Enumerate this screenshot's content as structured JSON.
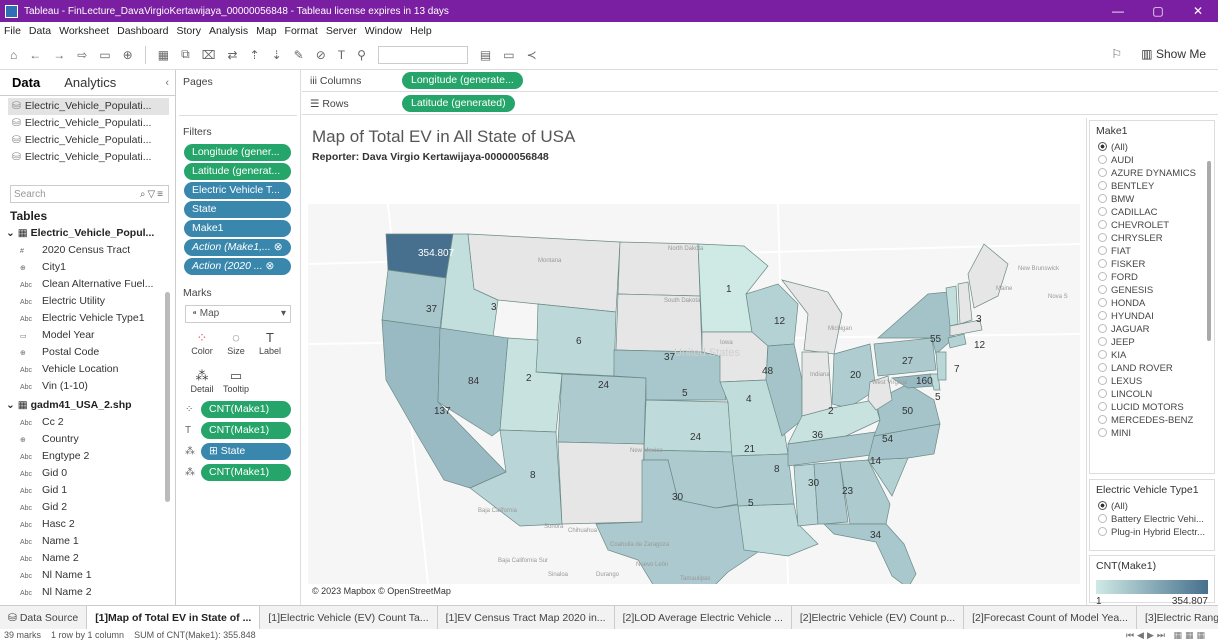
{
  "window": {
    "title": "Tableau - FinLecture_DavaVirgioKertawijaya_00000056848 - Tableau license expires in 13 days",
    "min": "—",
    "max": "▢",
    "close": "✕"
  },
  "menu": [
    "File",
    "Data",
    "Worksheet",
    "Dashboard",
    "Story",
    "Analysis",
    "Map",
    "Format",
    "Server",
    "Window",
    "Help"
  ],
  "toolbar": {
    "show_me": "Show Me"
  },
  "data_pane": {
    "tab_data": "Data",
    "tab_analytics": "Analytics",
    "datasources": [
      "Electric_Vehicle_Populati...",
      "Electric_Vehicle_Populati...",
      "Electric_Vehicle_Populati...",
      "Electric_Vehicle_Populati..."
    ],
    "search_placeholder": "Search",
    "tables_header": "Tables",
    "table1": "Electric_Vehicle_Popul...",
    "table1_fields": [
      {
        "t": "#",
        "n": "2020 Census Tract"
      },
      {
        "t": "⊕",
        "n": "City1"
      },
      {
        "t": "Abc",
        "n": "Clean Alternative Fuel..."
      },
      {
        "t": "Abc",
        "n": "Electric Utility"
      },
      {
        "t": "Abc",
        "n": "Electric Vehicle Type1"
      },
      {
        "t": "▭",
        "n": "Model Year"
      },
      {
        "t": "⊕",
        "n": "Postal Code"
      },
      {
        "t": "Abc",
        "n": "Vehicle Location"
      },
      {
        "t": "Abc",
        "n": "Vin (1-10)"
      }
    ],
    "table2": "gadm41_USA_2.shp",
    "table2_fields": [
      {
        "t": "Abc",
        "n": "Cc 2"
      },
      {
        "t": "⊕",
        "n": "Country"
      },
      {
        "t": "Abc",
        "n": "Engtype 2"
      },
      {
        "t": "Abc",
        "n": "Gid 0"
      },
      {
        "t": "Abc",
        "n": "Gid 1"
      },
      {
        "t": "Abc",
        "n": "Gid 2"
      },
      {
        "t": "Abc",
        "n": "Hasc 2"
      },
      {
        "t": "Abc",
        "n": "Name 1"
      },
      {
        "t": "Abc",
        "n": "Name 2"
      },
      {
        "t": "Abc",
        "n": "Nl Name 1"
      },
      {
        "t": "Abc",
        "n": "Nl Name 2"
      },
      {
        "t": "Abc",
        "n": "Type 2"
      },
      {
        "t": "Abc",
        "n": "Varname 2"
      }
    ]
  },
  "shelves": {
    "pages": "Pages",
    "filters": "Filters",
    "filter_pills": [
      {
        "label": "Longitude (gener...",
        "kind": "g"
      },
      {
        "label": "Latitude (generat...",
        "kind": "g"
      },
      {
        "label": "Electric Vehicle T...",
        "kind": "b"
      },
      {
        "label": "State",
        "kind": "b"
      },
      {
        "label": "Make1",
        "kind": "b"
      },
      {
        "label": "Action (Make1,... ⊗",
        "kind": "bi"
      },
      {
        "label": "Action (2020 ... ⊗",
        "kind": "bi"
      }
    ],
    "marks": "Marks",
    "mark_type": "Map",
    "mark_buttons": {
      "color": "Color",
      "size": "Size",
      "label": "Label",
      "detail": "Detail",
      "tooltip": "Tooltip"
    },
    "mark_pills": [
      {
        "icon": "⁘",
        "label": "CNT(Make1)",
        "kind": "g"
      },
      {
        "icon": "T",
        "label": "CNT(Make1)",
        "kind": "g"
      },
      {
        "icon": "⁂",
        "label": "⊞ State",
        "kind": "b"
      },
      {
        "icon": "⁂",
        "label": "CNT(Make1)",
        "kind": "g"
      }
    ],
    "columns_label": "iii Columns",
    "columns_pill": "Longitude (generate...",
    "rows_label": "☰ Rows",
    "rows_pill": "Latitude (generated)"
  },
  "view": {
    "title": "Map of Total EV in All State of USA",
    "subtitle": "Reporter: Dava Virgio Kertawijaya-00000056848",
    "copyright": "© 2023 Mapbox © OpenStreetMap",
    "basemap_labels": [
      "North Dakota",
      "South Dakota",
      "Montana",
      "New Brunswick",
      "Maine",
      "Nova S",
      "Michigan",
      "Iowa",
      "Indiana",
      "West Virginia",
      "New Mexico",
      "Baja California",
      "Sonora",
      "Chihuahua",
      "Coahuila de Zaragoza",
      "Baja California Sur",
      "Sinaloa",
      "Durango",
      "Nuevo León",
      "Tamaulipas",
      "Mexico",
      "United States"
    ],
    "state_counts": [
      {
        "name": "Washington",
        "value": 354807
      },
      {
        "name": "Oregon",
        "value": 37
      },
      {
        "name": "Idaho",
        "value": 3
      },
      {
        "name": "California",
        "value": 137
      },
      {
        "name": "Nevada",
        "value": 84
      },
      {
        "name": "Utah",
        "value": 2
      },
      {
        "name": "Arizona",
        "value": 8
      },
      {
        "name": "Wyoming",
        "value": 6
      },
      {
        "name": "Colorado",
        "value": 24
      },
      {
        "name": "Nebraska",
        "value": 37
      },
      {
        "name": "Kansas",
        "value": 5
      },
      {
        "name": "Oklahoma",
        "value": 24
      },
      {
        "name": "Texas",
        "value": 30
      },
      {
        "name": "Minnesota",
        "value": 1
      },
      {
        "name": "Wisconsin",
        "value": 12
      },
      {
        "name": "Missouri",
        "value": 4
      },
      {
        "name": "Illinois",
        "value": 48
      },
      {
        "name": "Arkansas",
        "value": 21
      },
      {
        "name": "Louisiana",
        "value": 5
      },
      {
        "name": "Mississippi",
        "value": 8
      },
      {
        "name": "Alabama",
        "value": 30
      },
      {
        "name": "Georgia",
        "value": 23
      },
      {
        "name": "Florida",
        "value": 34
      },
      {
        "name": "Tennessee",
        "value": 36
      },
      {
        "name": "Kentucky",
        "value": 2
      },
      {
        "name": "Ohio",
        "value": 20
      },
      {
        "name": "North Carolina",
        "value": 54
      },
      {
        "name": "South Carolina",
        "value": 14
      },
      {
        "name": "Virginia",
        "value": 50
      },
      {
        "name": "Pennsylvania",
        "value": 27
      },
      {
        "name": "New York",
        "value": 55
      },
      {
        "name": "Maryland",
        "value": 160
      },
      {
        "name": "Delaware",
        "value": 5
      },
      {
        "name": "New Jersey",
        "value": 7
      },
      {
        "name": "Connecticut",
        "value": 12
      },
      {
        "name": "Vermont",
        "value": 3
      }
    ],
    "label_washington": "354.807"
  },
  "legends": {
    "make_title": "Make1",
    "make_items": [
      "(All)",
      "AUDI",
      "AZURE DYNAMICS",
      "BENTLEY",
      "BMW",
      "CADILLAC",
      "CHEVROLET",
      "CHRYSLER",
      "FIAT",
      "FISKER",
      "FORD",
      "GENESIS",
      "HONDA",
      "HYUNDAI",
      "JAGUAR",
      "JEEP",
      "KIA",
      "LAND ROVER",
      "LEXUS",
      "LINCOLN",
      "LUCID MOTORS",
      "MERCEDES-BENZ",
      "MINI"
    ],
    "type_title": "Electric Vehicle Type1",
    "type_items": [
      "(All)",
      "Battery Electric Vehi...",
      "Plug-in Hybrid Electr..."
    ],
    "cnt_title": "CNT(Make1)",
    "cnt_min": "1",
    "cnt_max": "354.807",
    "colors": {
      "low": "#cfe9e5",
      "high": "#46708d"
    }
  },
  "sheet_tabs": {
    "data_source": "Data Source",
    "tabs": [
      "[1]Map of Total EV in State of ...",
      "[1]Electric Vehicle (EV) Count Ta...",
      "[1]EV Census Tract Map 2020 in...",
      "[2]LOD Average Electric Vehicle ...",
      "[2]Electric Vehicle (EV) Count p...",
      "[2]Forecast Count of Model Yea...",
      "[3]Electric Range Cou"
    ]
  },
  "status": {
    "marks": "39 marks",
    "rows": "1 row by 1 column",
    "sum": "SUM of CNT(Make1): 355.848"
  }
}
